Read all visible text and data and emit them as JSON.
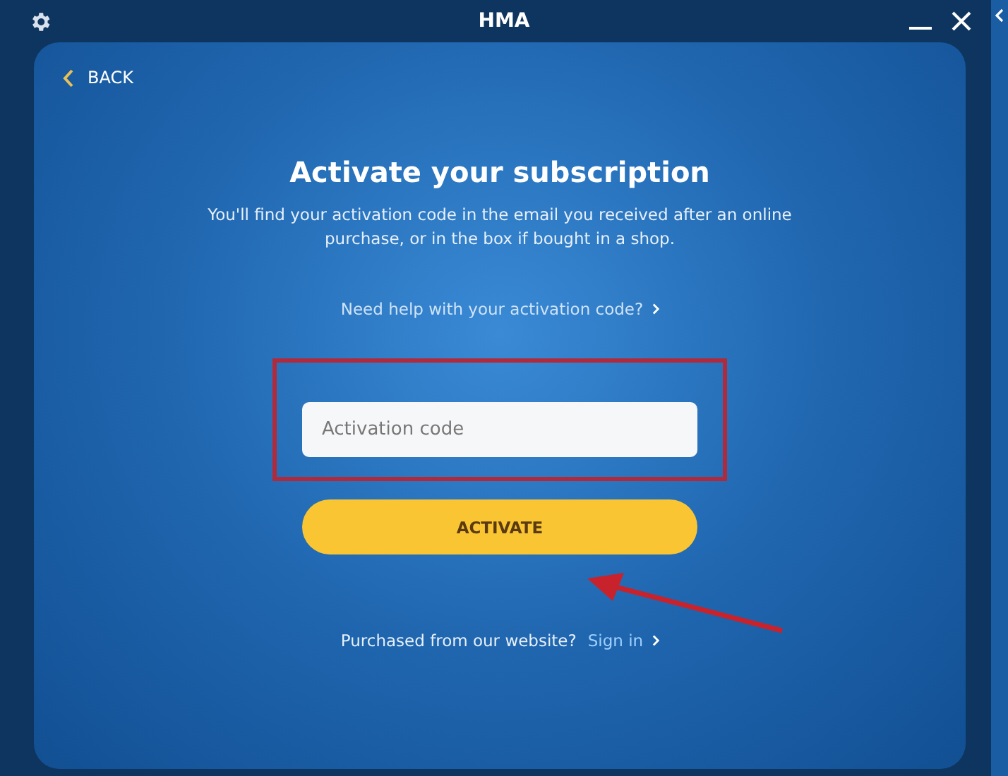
{
  "window": {
    "title": "HMA"
  },
  "back": {
    "label": "BACK"
  },
  "heading": "Activate your subscription",
  "description": "You'll find your activation code in the email you received after an online purchase, or in the box if bought in a shop.",
  "help_link": "Need help with your activation code?",
  "code_field": {
    "placeholder": "Activation code",
    "highlighted": true
  },
  "activate_button": "ACTIVATE",
  "annotation_arrow": true,
  "footer": {
    "text": "Purchased from our website?",
    "link": "Sign in"
  }
}
